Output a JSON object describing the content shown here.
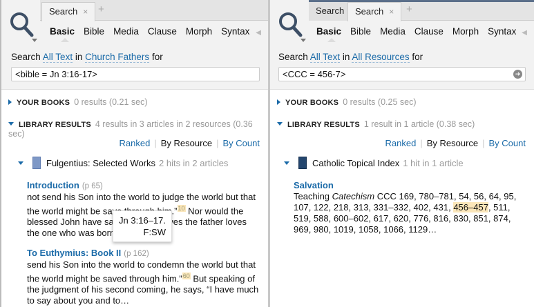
{
  "left": {
    "tabs": [
      {
        "label": "Search",
        "close": "×"
      }
    ],
    "add_tab": "+",
    "modes": [
      "Basic",
      "Bible",
      "Media",
      "Clause",
      "Morph",
      "Syntax"
    ],
    "search_prefix": "Search",
    "scope": "All Text",
    "in": "in",
    "collection": "Church Fathers",
    "for": "for",
    "query": "<bible = Jn 3:16-17>",
    "your_books": {
      "label": "YOUR BOOKS",
      "meta": "0 results (0.21 sec)"
    },
    "library": {
      "label": "LIBRARY RESULTS",
      "meta": "4 results in 3 articles in 2 resources (0.36 sec)"
    },
    "sort": [
      "Ranked",
      "By Resource",
      "By Count"
    ],
    "resource": {
      "title": "Fulgentius: Selected Works",
      "meta": "2 hits in 2 articles"
    },
    "entries": [
      {
        "title": "Introduction",
        "page": "(p 65)",
        "before": "not send his Son into the world to judge the world but that the world might be save through him.”",
        "fn": "10",
        "after": " Nor would the blessed John have said, “He who loves the father loves the one who was born of…"
      },
      {
        "title": "To Euthymius: Book II",
        "page": "(p 162)",
        "before": "send his Son into the world to condemn the world but that the world might be saved through him.”",
        "fn": "60",
        "after": " But speaking of the judgment of his second coming, he says, “I have much to say about you and to…"
      }
    ],
    "tooltip": {
      "line1": "Jn 3:16–17.",
      "line2": "F:SW"
    }
  },
  "right": {
    "tabs": [
      {
        "label": "Search"
      },
      {
        "label": "Search"
      }
    ],
    "add_tab": "+",
    "modes": [
      "Basic",
      "Bible",
      "Media",
      "Clause",
      "Morph",
      "Syntax"
    ],
    "search_prefix": "Search",
    "scope": "All Text",
    "in": "in",
    "collection": "All Resources",
    "for": "for",
    "query": "<CCC = 456-7>",
    "your_books": {
      "label": "YOUR BOOKS",
      "meta": "0 results (0.25 sec)"
    },
    "library": {
      "label": "LIBRARY RESULTS",
      "meta": "1 result in 1 article (0.38 sec)"
    },
    "sort": [
      "Ranked",
      "By Resource",
      "By Count"
    ],
    "resource": {
      "title": "Catholic Topical Index",
      "meta": "1 hit in 1 article"
    },
    "entry": {
      "title": "Salvation",
      "lead": "Teaching ",
      "italic": "Catechism",
      "before": " CCC 169, 780–781, 54, 56, 64, 95, 107, 122, 218, 313, 331–332, 402, 431, ",
      "hit": "456–457",
      "after": ", 511, 519, 588, 600–602, 617, 620, 776, 816, 830, 851, 874, 969, 980, 1019, 1058, 1066, 1129…"
    }
  }
}
